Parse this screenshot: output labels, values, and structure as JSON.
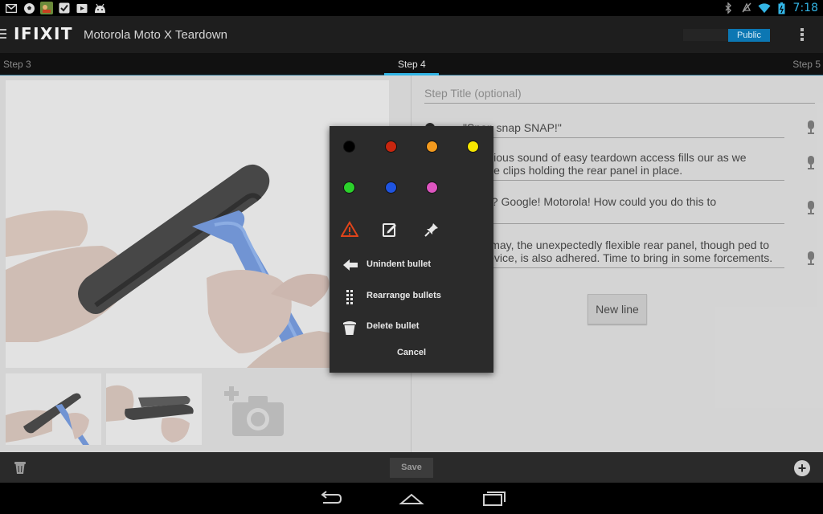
{
  "status_bar": {
    "left_icons": [
      "gmail-icon",
      "soccer-ball-icon",
      "game-app-icon",
      "checkmark-icon",
      "play-store-icon",
      "android-icon"
    ],
    "right_icons": [
      "bluetooth-icon",
      "mute-icon",
      "wifi-icon",
      "battery-icon"
    ],
    "time": "7:18"
  },
  "action_bar": {
    "logo": "IFIXIT",
    "title": "Motorola Moto X Teardown",
    "public_label": "Public"
  },
  "tabs": {
    "prev": "Step 3",
    "current": "Step 4",
    "next": "Step 5"
  },
  "editor": {
    "step_title_placeholder": "Step Title (optional)",
    "bullets": [
      {
        "color": "#000000",
        "text": "\"Snap snap SNAP!\""
      },
      {
        "color": "#000000",
        "text": "melodious sound of easy teardown access fills our as we release clips holding the rear panel in place."
      },
      {
        "color": "#000000",
        "text": "is this? Google! Motorola! How could you do this to"
      },
      {
        "color": "#000000",
        "text": "ur dismay, the unexpectedly flexible rear panel, though ped to the device, is also adhered. Time to bring in some forcements."
      }
    ],
    "new_line_label": "New line"
  },
  "bottom_bar": {
    "save_label": "Save"
  },
  "popup": {
    "colors": [
      {
        "name": "black",
        "hex": "#000000"
      },
      {
        "name": "red",
        "hex": "#c8260f"
      },
      {
        "name": "orange",
        "hex": "#f39a1e"
      },
      {
        "name": "yellow",
        "hex": "#f6e600"
      },
      {
        "name": "green",
        "hex": "#2bd12b"
      },
      {
        "name": "blue",
        "hex": "#1f54e0"
      },
      {
        "name": "violet",
        "hex": "#de55c0"
      }
    ],
    "tools": [
      "warning-icon",
      "note-icon",
      "pin-icon"
    ],
    "menu": [
      {
        "icon": "arrow-left-icon",
        "label": "Unindent bullet"
      },
      {
        "icon": "drag-handle-icon",
        "label": "Rearrange bullets"
      },
      {
        "icon": "trash-icon",
        "label": "Delete bullet"
      }
    ],
    "cancel_label": "Cancel"
  }
}
